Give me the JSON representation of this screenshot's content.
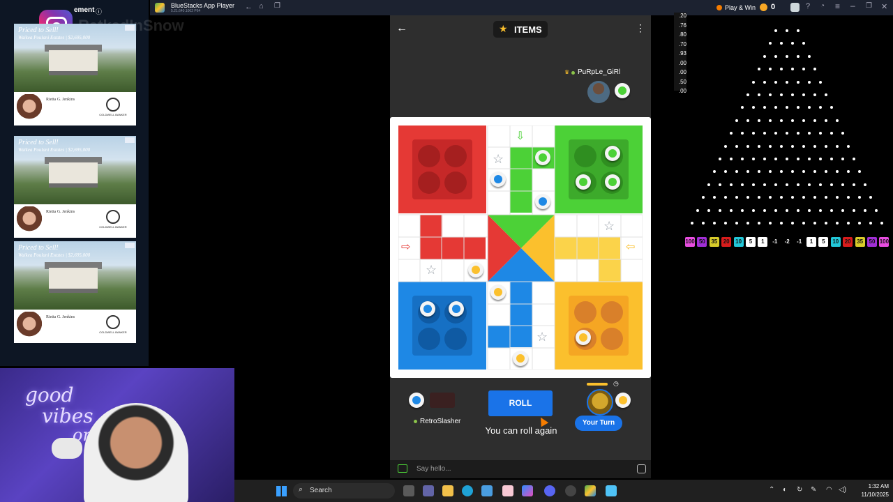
{
  "titlebar": {
    "app_name": "BlueStacks App Player",
    "version": "5.21.640.1002 P64",
    "play_win": "Play & Win",
    "coins": "0"
  },
  "overlay": {
    "element_label": "ement",
    "watermark": "RatkedInSnow"
  },
  "ads": [
    {
      "headline": "Priced to Sell!",
      "sub": "Waikea Poulani Estates | $2,695,000",
      "agent_name": "Rietta G. Jenkins",
      "brand": "COLDWELL BANKER"
    },
    {
      "headline": "Priced to Sell!",
      "sub": "Waikea Poulani Estates | $2,695,000",
      "agent_name": "Rietta G. Jenkins",
      "brand": "COLDWELL BANKER"
    },
    {
      "headline": "Priced to Sell!",
      "sub": "Waikea Poulani Estates | $2,695,000",
      "agent_name": "Rietta G. Jenkins",
      "brand": "COLDWELL BANKER"
    }
  ],
  "game": {
    "header_title": "ITEMS",
    "opponent_top": "PuRpLe_GiRl",
    "opponent_bottom": "RetroSlasher",
    "roll_button": "ROLL",
    "status_message": "You can roll again",
    "your_turn": "Your Turn",
    "chat_placeholder": "Say hello..."
  },
  "plinko": {
    "history": [
      ".20",
      ".76",
      ".80",
      ".70",
      ".93",
      ".00",
      ".00",
      ".50",
      ".00"
    ],
    "multipliers": [
      "100",
      "50",
      "35",
      "20",
      "10",
      "5",
      "1",
      "-1",
      "-2",
      "-1",
      "1",
      "5",
      "10",
      "20",
      "35",
      "50",
      "100"
    ],
    "colors": [
      "#e84de0",
      "#a12fd6",
      "#d8cb2a",
      "#d81c1c",
      "#22c7d8",
      "#ffffff",
      "#ffffff",
      "#000000",
      "#000000",
      "#000000",
      "#ffffff",
      "#ffffff",
      "#22c7d8",
      "#d81c1c",
      "#d8cb2a",
      "#a12fd6",
      "#e84de0"
    ]
  },
  "webcam": {
    "neon_text_1": "good",
    "neon_text_2": "vibes",
    "neon_text_3": "on"
  },
  "taskbar": {
    "search": "Search",
    "time": "1:32 AM",
    "date": "11/10/2025"
  },
  "colors": {
    "red": "#e53935",
    "green": "#4cd137",
    "blue": "#1e88e5",
    "yellow": "#fbc02d",
    "roll_button": "#1a73e8"
  }
}
